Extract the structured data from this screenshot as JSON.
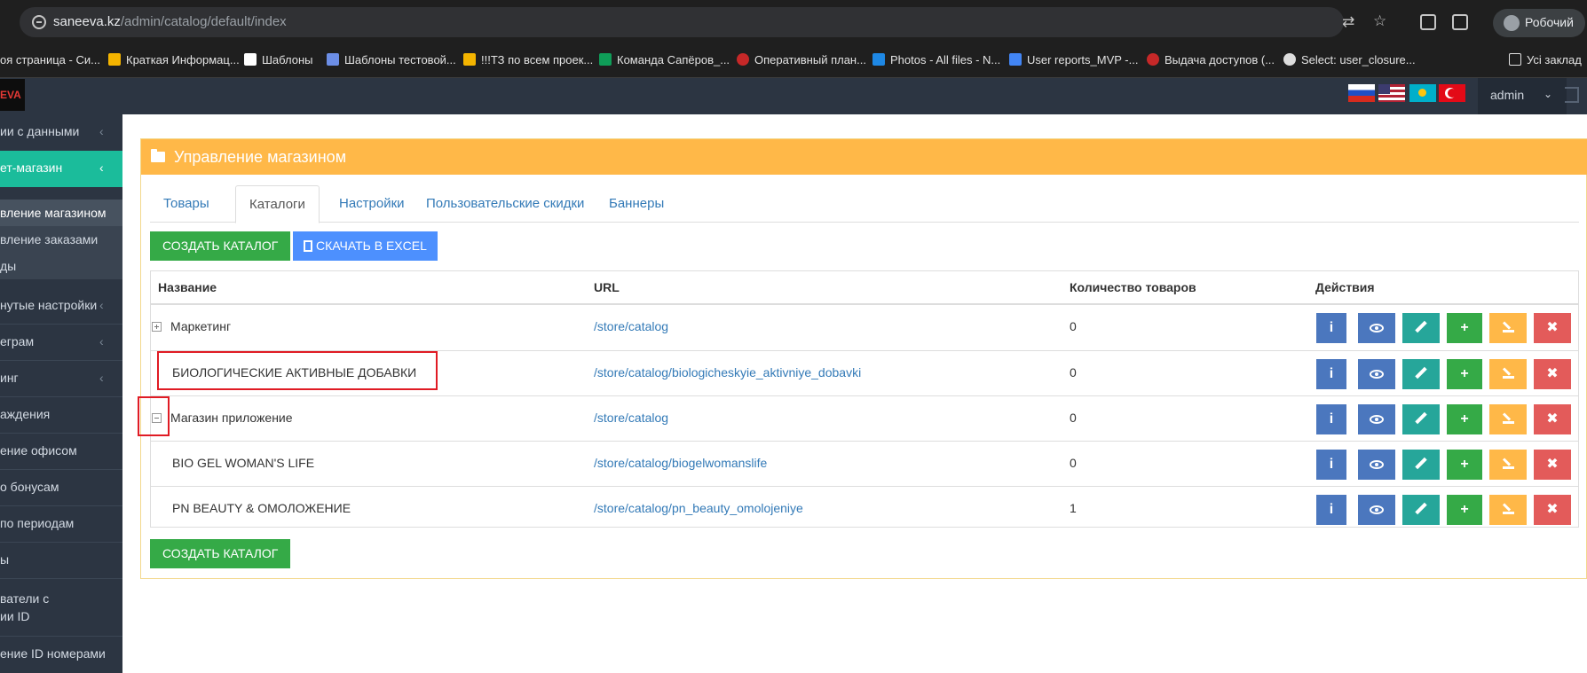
{
  "browser": {
    "url_host": "saneeva.kz",
    "url_path": "/admin/catalog/default/index",
    "profile_name": "Робочий",
    "bookmarks": [
      "оя страница - Си...",
      "Краткая Информац...",
      "Шаблоны",
      "Шаблоны тестовой...",
      "!!!ТЗ по всем проек...",
      "Команда Сапёров_...",
      "Оперативный план...",
      "Photos - All files - N...",
      "User reports_MVP -...",
      "Выдача доступов (...",
      "Select: user_closure...",
      "Усі заклад"
    ]
  },
  "header": {
    "logo_text": "EVA",
    "user": "admin"
  },
  "sidebar": {
    "items": [
      "ии с данными",
      "ет-магазин",
      "вление магазином",
      "вление заказами",
      "ды",
      "нутые настройки",
      "еграм",
      "инг",
      "аждения",
      "ение офисом",
      "о бонусам",
      "по периодам",
      "ы",
      "ватели с",
      "ии ID",
      "ение ID номерами"
    ]
  },
  "panel": {
    "title": "Управление магазином",
    "tabs": [
      "Товары",
      "Каталоги",
      "Настройки",
      "Пользовательские скидки",
      "Баннеры"
    ],
    "create_label": "Создать каталог",
    "excel_label": "Скачать в Excel",
    "create_bottom_label": "Создать каталог"
  },
  "table": {
    "headers": [
      "Название",
      "URL",
      "Количество товаров",
      "Действия"
    ],
    "rows": [
      {
        "name": "Маркетинг",
        "url": "/store/catalog",
        "count": "0"
      },
      {
        "name": "БИОЛОГИЧЕСКИЕ АКТИВНЫЕ ДОБАВКИ",
        "url": "/store/catalog/biologicheskyie_aktivniye_dobavki",
        "count": "0"
      },
      {
        "name": "Магазин приложение",
        "url": "/store/catalog",
        "count": "0"
      },
      {
        "name": "BIO GEL WOMAN'S LIFE",
        "url": "/store/catalog/biogelwomanslife",
        "count": "0"
      },
      {
        "name": "PN BEAUTY & ОМОЛОЖЕНИЕ",
        "url": "/store/catalog/pn_beauty_omolojeniye",
        "count": "1"
      }
    ]
  },
  "colors": {
    "panel_header": "#ffb848",
    "sidebar_active": "#1bbc9b",
    "highlight": "#e01b24"
  }
}
